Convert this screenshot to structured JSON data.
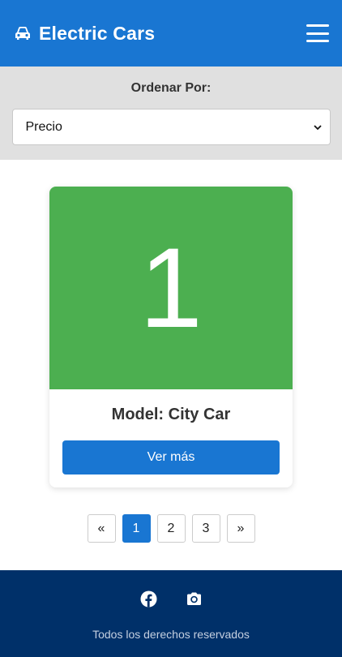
{
  "header": {
    "title": "Electric Cars",
    "icon": "car-icon",
    "menu_icon": "hamburger-menu-icon",
    "color": "#1976d2"
  },
  "sort": {
    "label": "Ordenar Por:",
    "selected": "Precio"
  },
  "card": {
    "number": "1",
    "title": "Model: City Car",
    "button_label": "Ver más",
    "image_color": "#4caf50"
  },
  "pagination": {
    "prev": "«",
    "pages": [
      "1",
      "2",
      "3"
    ],
    "active": "1",
    "next": "»"
  },
  "footer": {
    "social": [
      "facebook-icon",
      "instagram-camera-icon"
    ],
    "text": "Todos los derechos reservados",
    "color": "#003069"
  }
}
